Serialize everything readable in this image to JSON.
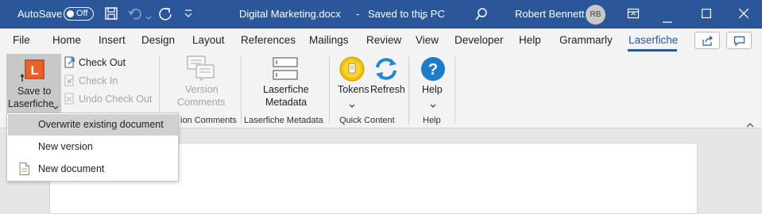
{
  "titlebar": {
    "autosave_label": "AutoSave",
    "autosave_state": "Off",
    "doc_title": "Digital Marketing.docx",
    "save_status": "Saved to this PC",
    "user_name": "Robert Bennett",
    "user_initials": "RB",
    "bg_color": "#2b579a"
  },
  "tabs": [
    "File",
    "Home",
    "Insert",
    "Design",
    "Layout",
    "References",
    "Mailings",
    "Review",
    "View",
    "Developer",
    "Help",
    "Grammarly",
    "Laserfiche"
  ],
  "active_tab": "Laserfiche",
  "ribbon": {
    "save_to_laserfiche": [
      "Save to",
      "Laserfiche"
    ],
    "check_out": "Check Out",
    "check_in": "Check In",
    "undo_check_out": "Undo Check Out",
    "version_comments": [
      "Version",
      "Comments"
    ],
    "group_version_comments": "ion Comments",
    "laserfiche_metadata": [
      "Laserfiche",
      "Metadata"
    ],
    "group_laserfiche_metadata": "Laserfiche Metadata",
    "tokens": "Tokens",
    "refresh": "Refresh",
    "group_quick_content": "Quick Content",
    "help": "Help",
    "group_help": "Help"
  },
  "dropdown": {
    "items": [
      "Overwrite existing document",
      "New version",
      "New document"
    ],
    "highlighted": "Overwrite existing document"
  }
}
